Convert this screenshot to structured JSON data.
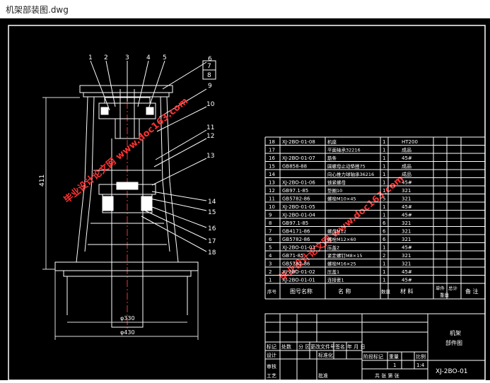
{
  "window": {
    "title": "机架部装图.dwg"
  },
  "drawing": {
    "callouts_top": [
      "1",
      "2",
      "3",
      "4",
      "5"
    ],
    "callouts_right": [
      "6",
      "7",
      "8",
      "9",
      "10",
      "11",
      "12",
      "13",
      "14",
      "15",
      "16",
      "17",
      "18"
    ],
    "dim_height": "411",
    "dim_d1": "φ330",
    "dim_d2": "φ430",
    "watermark": "毕业设计论文网 www.doc163.com"
  },
  "bom": {
    "rows": [
      {
        "no": "18",
        "code": "XJ-2BO-01-08",
        "name": "机座",
        "qty": "1",
        "mat": "HT200"
      },
      {
        "no": "17",
        "code": "",
        "name": "平面轴承32216",
        "qty": "1",
        "mat": "成品"
      },
      {
        "no": "16",
        "code": "XJ-2BO-01-07",
        "name": "筋条",
        "qty": "1",
        "mat": "45#"
      },
      {
        "no": "15",
        "code": "GB858-88",
        "name": "圆螺母止动垫圈75",
        "qty": "1",
        "mat": "成品"
      },
      {
        "no": "14",
        "code": "",
        "name": "向心推力球轴承36216",
        "qty": "1",
        "mat": "成品"
      },
      {
        "no": "13",
        "code": "XJ-2BO-01-06",
        "name": "锁紧螺母",
        "qty": "1",
        "mat": "45#"
      },
      {
        "no": "12",
        "code": "GB97.1-85",
        "name": "垫圈10",
        "qty": "1",
        "mat": "321"
      },
      {
        "no": "11",
        "code": "GB5782-86",
        "name": "螺栓M10×45",
        "qty": "5",
        "mat": "321"
      },
      {
        "no": "10",
        "code": "XJ-2BO-01-05",
        "name": "",
        "qty": "1",
        "mat": "45#"
      },
      {
        "no": "9",
        "code": "XJ-2BO-01-04",
        "name": "",
        "qty": "1",
        "mat": "45#"
      },
      {
        "no": "8",
        "code": "GB97.1-85",
        "name": "",
        "qty": "6",
        "mat": "321"
      },
      {
        "no": "7",
        "code": "GB4171-86",
        "name": "螺母M12",
        "qty": "6",
        "mat": "321"
      },
      {
        "no": "6",
        "code": "GB5782-86",
        "name": "螺栓M12×60",
        "qty": "6",
        "mat": "321"
      },
      {
        "no": "5",
        "code": "XJ-2BO-01-03",
        "name": "压盖2",
        "qty": "1",
        "mat": "45#"
      },
      {
        "no": "4",
        "code": "GB71-85",
        "name": "紧定螺钉M8×15",
        "qty": "2",
        "mat": "321"
      },
      {
        "no": "3",
        "code": "GB5782-86",
        "name": "螺栓M16×25",
        "qty": "1",
        "mat": "321"
      },
      {
        "no": "2",
        "code": "XJ-2BO-01-02",
        "name": "压盖1",
        "qty": "1",
        "mat": "45#"
      },
      {
        "no": "1",
        "code": "XJ-2BO-01-01",
        "name": "连接套1",
        "qty": "1",
        "mat": "45#"
      }
    ],
    "header": {
      "no": "序号",
      "code": "图号名称",
      "name": "名    称",
      "qty": "数量",
      "mat": "材    料",
      "w1": "单件",
      "w2": "总计",
      "weight": "重量",
      "note": "备  注"
    }
  },
  "titleblock": {
    "mark": "标记",
    "count": "处数",
    "zone": "分 区",
    "change_doc": "更改文件号",
    "sign": "签名",
    "date": "年 月 日",
    "design": "设计",
    "standard": "标准化",
    "review": "审核",
    "process": "工艺",
    "approve": "批准",
    "stage_mark": "阶段标记",
    "weight": "重量",
    "scale": "比例",
    "scale_value": "1:4",
    "sheet_qty": "1",
    "sheets": "共   张  第   张",
    "part_name_line1": "机架",
    "part_name_line2": "部件图",
    "drawing_no": "XJ-2BO-01"
  }
}
